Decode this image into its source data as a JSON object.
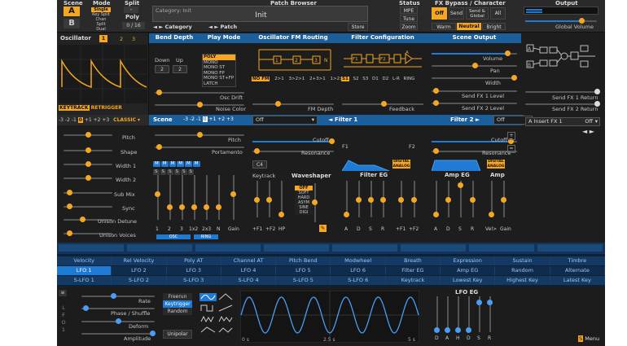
{
  "header": {
    "scene_label": "Scene",
    "scene_a": "A",
    "scene_b": "B",
    "mode_label": "Mode",
    "mode_options": [
      "Single",
      "Key Split",
      "Chan Split",
      "Dual"
    ],
    "split_label": "Split",
    "split_value": "-",
    "poly_label": "Poly",
    "poly_value": "0 / 16",
    "patch_browser_label": "Patch Browser",
    "category_text": "Category: Init",
    "patch_name": "Init",
    "category_btn": "Category",
    "patch_btn": "Patch",
    "store_btn": "Store",
    "status_label": "Status",
    "mpe": "MPE",
    "tune": "Tune",
    "zoom": "Zoom",
    "fx_label": "FX Bypass / Character",
    "fx_off": "Off",
    "fx_send": "Send",
    "fx_send_global": "Send & Global",
    "fx_all": "All",
    "char_warm": "Warm",
    "char_neutral": "Neutral",
    "char_bright": "Bright",
    "output_label": "Output",
    "global_volume": "Global Volume"
  },
  "osc": {
    "title": "Oscillator",
    "tabs": [
      "1",
      "2",
      "3"
    ],
    "keytrack": "KEYTRACK",
    "retrigger": "RETRIGGER",
    "octave": [
      "-3",
      "-2",
      "-1",
      "0",
      "+1",
      "+2",
      "+3"
    ],
    "type": "CLASSIC",
    "params": [
      "Pitch",
      "Shape",
      "Width 1",
      "Width 2",
      "Sub Mix",
      "Sync",
      "Unison Detune",
      "Unison Voices"
    ]
  },
  "section_headers": {
    "bend_depth": "Bend Depth",
    "play_mode": "Play Mode",
    "fm": "Oscillator FM Routing",
    "filter_cfg": "Filter Configuration",
    "scene_output": "Scene Output"
  },
  "bend": {
    "down_label": "Down",
    "up_label": "Up",
    "down": "2",
    "up": "2"
  },
  "playmode": [
    "POLY",
    "MONO",
    "MONO ST",
    "MONO FP",
    "MONO ST+FP",
    "LATCH"
  ],
  "mid_top": {
    "osc_drift": "Osc Drift",
    "noise_color": "Noise Color",
    "fm_depth": "FM Depth",
    "feedback": "Feedback",
    "fm_routes": [
      "NO FM",
      "2>1",
      "3>2>1",
      "2+3>1",
      "1>2>3"
    ],
    "filter_routes": [
      "S1",
      "S2",
      "S3",
      "D1",
      "D2",
      "L-R",
      "RING"
    ],
    "volume": "Volume",
    "pan": "Pan",
    "width": "Width",
    "send_fx1": "Send FX 1 Level",
    "send_fx2": "Send FX 2 Level"
  },
  "fxr": {
    "ret1": "Send FX 1 Return",
    "ret2": "Send FX 2 Return",
    "insert": "A Insert FX 1",
    "insert_val": "Off"
  },
  "scenebar": {
    "scene": "Scene",
    "octave": [
      "-3",
      "-2",
      "-1",
      "0",
      "+1",
      "+2",
      "+3"
    ],
    "filt1_sel": "Off",
    "filter1": "Filter 1",
    "filter2": "Filter 2",
    "filt2_sel": "Off"
  },
  "lower": {
    "pitch": "Pitch",
    "portamento": "Portamento",
    "cutoff": "Cutoff",
    "resonance": "Resonance",
    "cutoff2": "Cutoff",
    "resonance2": "Resonance",
    "f1": "F1",
    "f2": "F2",
    "keytrack": "Keytrack",
    "c4": "C4",
    "waveshaper": "Waveshaper",
    "ws_opts": [
      "OFF",
      "SOFT",
      "HARD",
      "ASYM",
      "SINE",
      "DIGI"
    ],
    "ks_labels": [
      "+F1",
      "+F2",
      "HP"
    ],
    "filter_eg": "Filter EG",
    "amp_eg": "Amp EG",
    "amp": "Amp",
    "digital": "DIGITAL",
    "analog": "ANALOG",
    "feg_labels": [
      "A",
      "D",
      "S",
      "R",
      "+F1",
      "+F2"
    ],
    "aeg_labels": [
      "A",
      "D",
      "S",
      "R",
      "Vel>",
      "Gain"
    ],
    "mixer_labels": [
      "1",
      "2",
      "3",
      "1x2",
      "2x3",
      "N",
      "Gain"
    ],
    "mixer_flags": [
      "M",
      "S"
    ],
    "osc_tag": "OSC",
    "ring_tag": "RING"
  },
  "mod": {
    "row1": [
      "Velocity",
      "Rel Velocity",
      "Poly AT",
      "Channel AT",
      "Pitch Bend",
      "Modwheel",
      "Breath",
      "Expression",
      "Sustain",
      "Timbre"
    ],
    "row2": [
      "LFO 1",
      "LFO 2",
      "LFO 3",
      "LFO 4",
      "LFO 5",
      "LFO 6",
      "Filter EG",
      "Amp EG",
      "Random",
      "Alternate"
    ],
    "row3": [
      "S-LFO 1",
      "S-LFO 2",
      "S-LFO 3",
      "S-LFO 4",
      "S-LFO 5",
      "S-LFO 6",
      "Keytrack",
      "Lowest Key",
      "Highest Key",
      "Latest Key"
    ]
  },
  "lfo": {
    "tag": [
      "L",
      "F",
      "O",
      "1"
    ],
    "rate": "Rate",
    "phase": "Phase / Shuffle",
    "deform": "Deform",
    "amplitude": "Amplitude",
    "trig": [
      "Freerun",
      "Keytrigger",
      "Random"
    ],
    "unipolar": "Unipolar",
    "t0": "0 s",
    "t1": "2.5 s",
    "t2": "5 s",
    "lfo_eg": "LFO EG",
    "eg_labels": [
      "D",
      "A",
      "H",
      "D",
      "S",
      "R"
    ],
    "menu": "Menu"
  },
  "colors": {
    "accent": "#f5a623",
    "blue": "#1f7ad4",
    "bg": "#1d1d1d"
  }
}
